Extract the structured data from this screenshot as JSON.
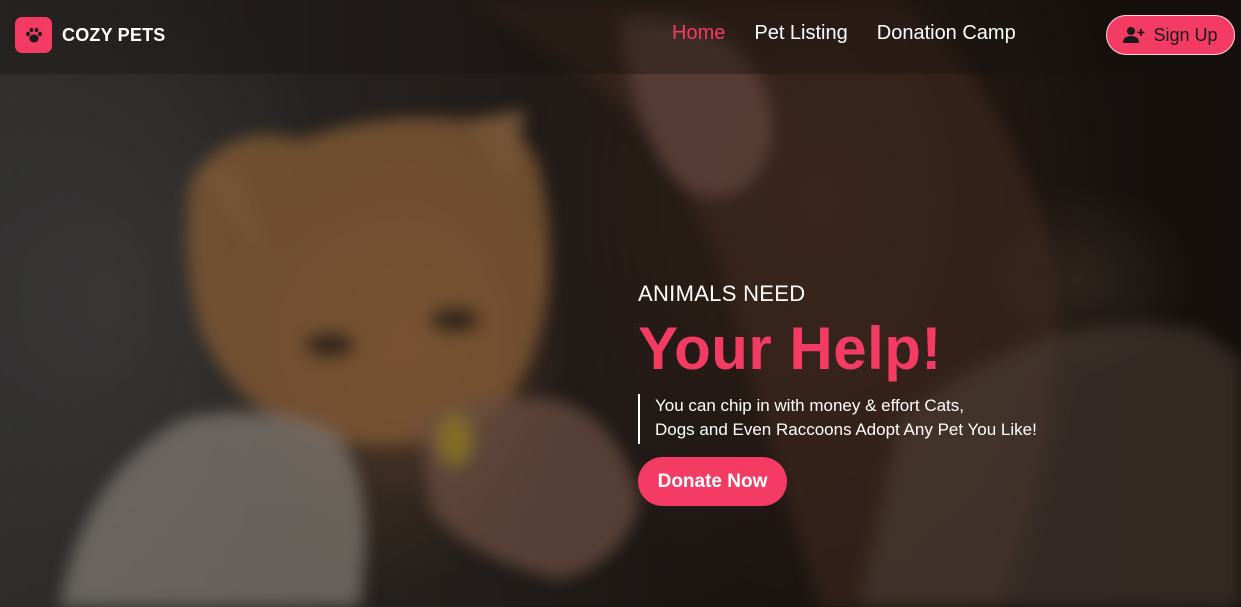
{
  "brand": {
    "name": "COZY PETS",
    "logo_icon": "paw-icon"
  },
  "nav": {
    "items": [
      {
        "label": "Home",
        "active": true
      },
      {
        "label": "Pet Listing",
        "active": false
      },
      {
        "label": "Donation Camp",
        "active": false
      }
    ],
    "signup": {
      "label": "Sign Up",
      "icon": "user-plus-icon"
    }
  },
  "hero": {
    "eyebrow": "ANIMALS NEED",
    "title": "Your Help!",
    "description_lines": [
      "You can chip in with money & effort Cats,",
      "Dogs and Even Raccoons Adopt Any Pet You Like!"
    ],
    "cta_label": "Donate Now"
  },
  "colors": {
    "accent": "#f43b64",
    "text": "#ffffff",
    "overlay": "#1b1613"
  }
}
